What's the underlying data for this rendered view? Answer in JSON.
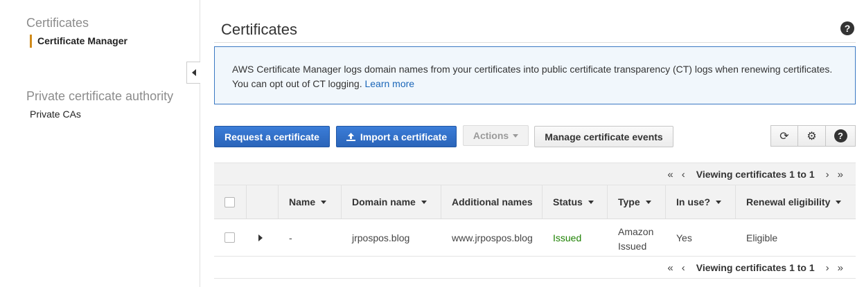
{
  "sidebar": {
    "section1_heading": "Certificates",
    "certificate_manager": "Certificate Manager",
    "section2_heading": "Private certificate authority",
    "private_cas": "Private CAs"
  },
  "header": {
    "title": "Certificates",
    "help_icon": "?"
  },
  "info": {
    "text": "AWS Certificate Manager logs domain names from your certificates into public certificate transparency (CT) logs when renewing certificates. You can opt out of CT logging.",
    "link": "Learn more"
  },
  "toolbar": {
    "request_label": "Request a certificate",
    "import_label": "Import a certificate",
    "actions_label": "Actions",
    "manage_events_label": "Manage certificate events",
    "refresh_icon": "⟳",
    "settings_icon": "⚙",
    "help_icon": "?"
  },
  "pagination": {
    "first": "«",
    "prev": "‹",
    "label": "Viewing certificates 1 to 1",
    "next": "›",
    "last": "»"
  },
  "table": {
    "columns": [
      "Name",
      "Domain name",
      "Additional names",
      "Status",
      "Type",
      "In use?",
      "Renewal eligibility"
    ],
    "rows": [
      {
        "name": "-",
        "domain": "jrpospos.blog",
        "additional": "www.jrpospos.blog",
        "status": "Issued",
        "type": "Amazon Issued",
        "in_use": "Yes",
        "renewal": "Eligible"
      }
    ]
  },
  "colors": {
    "accent_orange": "#d08a1a",
    "primary_blue": "#2d6ec9",
    "info_border": "#3a78c3",
    "status_green": "#1d8102"
  }
}
